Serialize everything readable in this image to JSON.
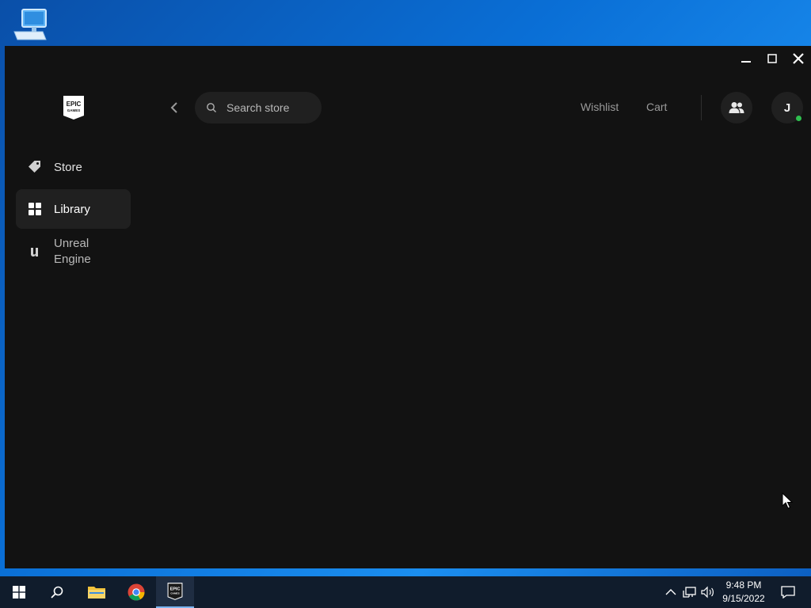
{
  "window": {
    "logo_text": "EPIC GAMES"
  },
  "header": {
    "search_placeholder": "Search store",
    "wishlist_label": "Wishlist",
    "cart_label": "Cart",
    "avatar_initial": "J"
  },
  "sidebar": {
    "items": [
      {
        "label": "Store",
        "icon": "tag-icon",
        "active": false
      },
      {
        "label": "Library",
        "icon": "grid-icon",
        "active": true
      },
      {
        "label": "Unreal Engine",
        "icon": "unreal-engine-icon",
        "active": false
      }
    ]
  },
  "taskbar": {
    "apps": [
      "start-icon",
      "search-icon",
      "file-explorer-icon",
      "chrome-icon",
      "epic-games-icon"
    ],
    "active_app": "epic-games-icon",
    "clock": {
      "time": "9:48 PM",
      "date": "9/15/2022"
    }
  },
  "colors": {
    "window_bg": "#121212",
    "surface": "#202020",
    "online": "#2fbf4f",
    "taskbar": "#101c2c"
  }
}
